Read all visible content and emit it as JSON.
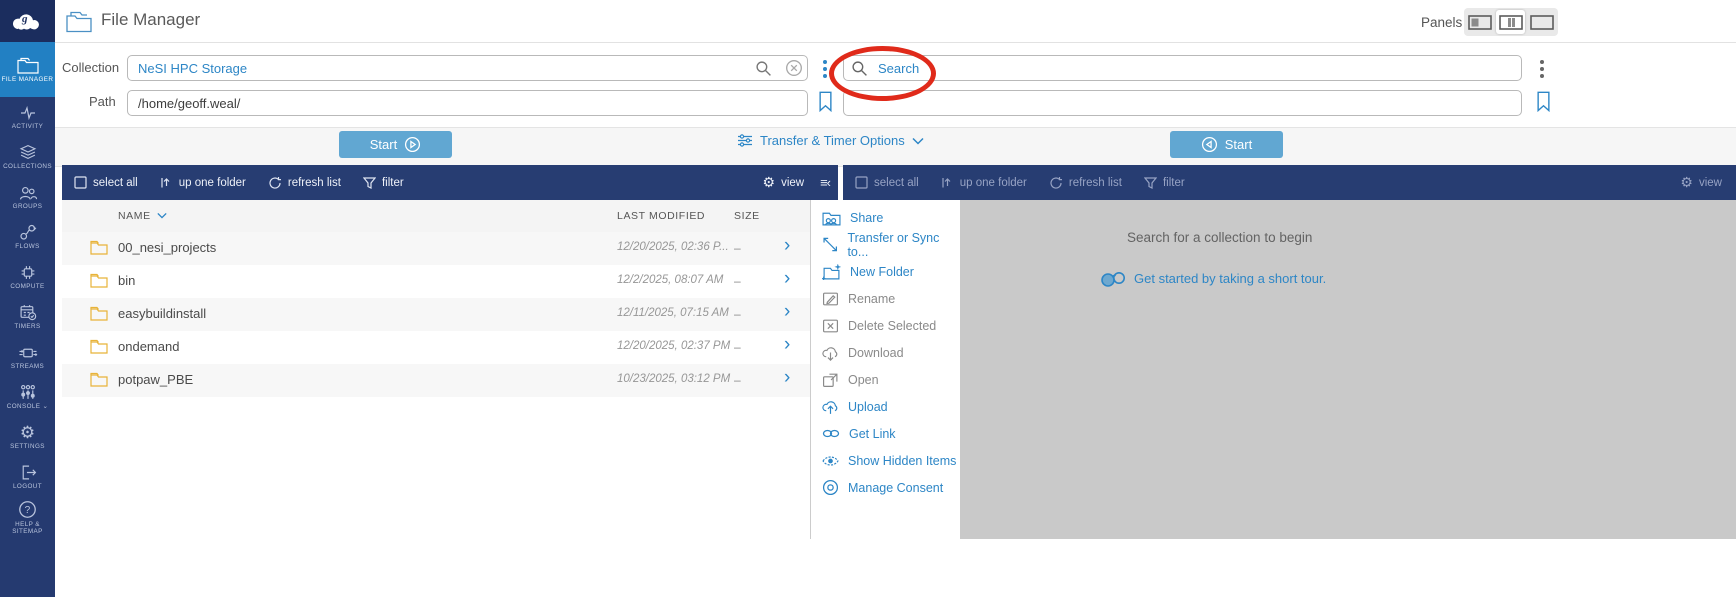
{
  "app": {
    "title": "File Manager"
  },
  "panels": {
    "label": "Panels"
  },
  "colors": {
    "accent_blue": "#2d86c6",
    "sidebar_navy": "#253a70",
    "toolbar_navy": "#273d72",
    "active_item_blue": "#2280c3",
    "start_button_blue": "#61a7d2",
    "annotation_red": "#e02a1a",
    "folder_yellow": "#e8b339",
    "right_pane_gray": "#c9c9c9"
  },
  "sidebar": {
    "items": [
      {
        "label": "FILE MANAGER",
        "icon": "folder-icon",
        "active": true
      },
      {
        "label": "ACTIVITY",
        "icon": "activity-icon"
      },
      {
        "label": "COLLECTIONS",
        "icon": "collections-icon"
      },
      {
        "label": "GROUPS",
        "icon": "groups-icon"
      },
      {
        "label": "FLOWS",
        "icon": "flows-icon"
      },
      {
        "label": "COMPUTE",
        "icon": "compute-icon"
      },
      {
        "label": "TIMERS",
        "icon": "timers-icon"
      },
      {
        "label": "STREAMS",
        "icon": "streams-icon"
      },
      {
        "label": "CONSOLE",
        "icon": "console-icon"
      },
      {
        "label": "SETTINGS",
        "icon": "settings-icon"
      },
      {
        "label": "LOGOUT",
        "icon": "logout-icon"
      },
      {
        "label": "HELP & SITEMAP",
        "icon": "help-icon"
      }
    ]
  },
  "left_pane": {
    "collection_label": "Collection",
    "collection_value": "NeSI HPC Storage",
    "path_label": "Path",
    "path_value": "/home/geoff.weal/",
    "start_button": "Start",
    "table": {
      "columns": {
        "name": "NAME",
        "last_modified": "LAST MODIFIED",
        "size": "SIZE"
      },
      "rows": [
        {
          "name": "00_nesi_projects",
          "last_modified": "12/20/2025, 02:36 P...",
          "size": "–"
        },
        {
          "name": "bin",
          "last_modified": "12/2/2025, 08:07 AM",
          "size": "–"
        },
        {
          "name": "easybuildinstall",
          "last_modified": "12/11/2025, 07:15 AM",
          "size": "–"
        },
        {
          "name": "ondemand",
          "last_modified": "12/20/2025, 02:37 PM",
          "size": "–"
        },
        {
          "name": "potpaw_PBE",
          "last_modified": "10/23/2025, 03:12 PM",
          "size": "–"
        }
      ]
    }
  },
  "transfer_options": {
    "label": "Transfer & Timer Options"
  },
  "toolbar": {
    "select_all": "select all",
    "up_one_folder": "up one folder",
    "refresh_list": "refresh list",
    "filter": "filter",
    "view": "view"
  },
  "right_pane": {
    "search_placeholder": "Search",
    "path_value": "",
    "start_button": "Start",
    "empty_state": {
      "message": "Search for a collection to begin",
      "tour_link": "Get started by taking a short tour."
    }
  },
  "menu": {
    "items": [
      {
        "label": "Share",
        "icon": "share-icon",
        "enabled": true
      },
      {
        "label": "Transfer or Sync to...",
        "icon": "transfer-icon",
        "enabled": true
      },
      {
        "label": "New Folder",
        "icon": "new-folder-icon",
        "enabled": true
      },
      {
        "label": "Rename",
        "icon": "rename-icon",
        "enabled": false
      },
      {
        "label": "Delete Selected",
        "icon": "delete-icon",
        "enabled": false
      },
      {
        "label": "Download",
        "icon": "download-icon",
        "enabled": false
      },
      {
        "label": "Open",
        "icon": "open-icon",
        "enabled": false
      },
      {
        "label": "Upload",
        "icon": "upload-icon",
        "enabled": true
      },
      {
        "label": "Get Link",
        "icon": "get-link-icon",
        "enabled": true
      },
      {
        "label": "Show Hidden Items",
        "icon": "show-hidden-icon",
        "enabled": true
      },
      {
        "label": "Manage Consent",
        "icon": "manage-consent-icon",
        "enabled": true
      }
    ]
  }
}
